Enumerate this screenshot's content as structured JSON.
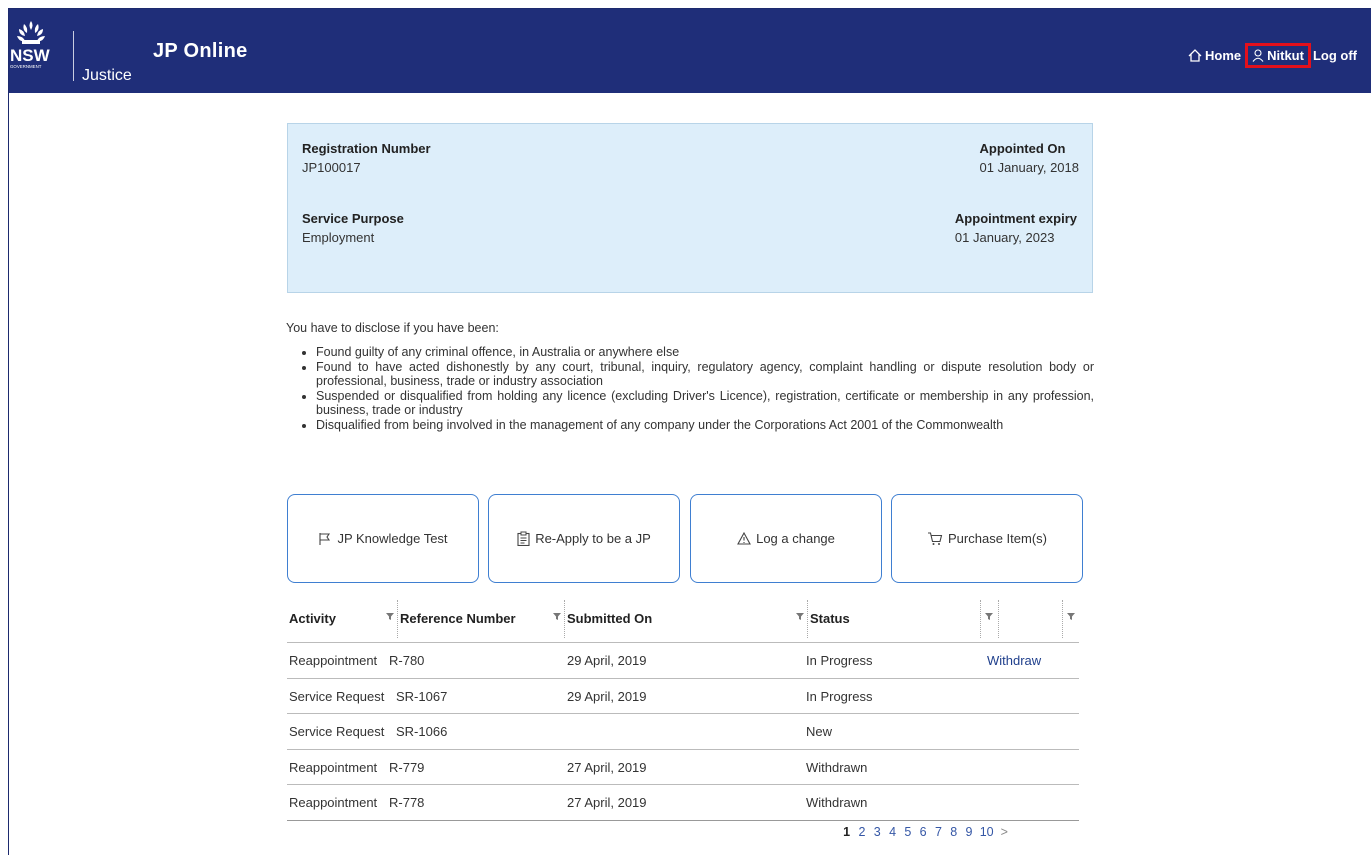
{
  "header": {
    "logo_text": "NSW",
    "logo_subtext": "GOVERNMENT",
    "dept": "Justice",
    "app_title": "JP Online",
    "nav": {
      "home": "Home",
      "user": "Nitkut",
      "logoff": "Log off"
    },
    "highlight_color": "#e3101c",
    "brand_color": "#1f2e79"
  },
  "info": {
    "registration_label": "Registration Number",
    "registration_value": "JP100017",
    "appointed_label": "Appointed On",
    "appointed_value": "01 January, 2018",
    "purpose_label": "Service Purpose",
    "purpose_value": "Employment",
    "expiry_label": "Appointment expiry",
    "expiry_value": "01 January, 2023"
  },
  "disclosure": {
    "intro": "You have to disclose if you have been:",
    "items": [
      "Found guilty of any criminal offence, in Australia or anywhere else",
      "Found to have acted dishonestly by any court, tribunal, inquiry, regulatory agency, complaint handling or dispute resolution body or professional, business, trade or industry association",
      "Suspended or disqualified from holding any licence (excluding Driver's Licence), registration, certificate or membership in any profession, business, trade or industry",
      "Disqualified from being involved in the management of any company under the Corporations Act 2001 of the Commonwealth"
    ]
  },
  "actions": {
    "knowledge_test": "JP Knowledge Test",
    "reapply": "Re-Apply to be a JP",
    "log_change": "Log a change",
    "purchase": "Purchase Item(s)"
  },
  "table": {
    "columns": [
      "Activity",
      "Reference Number",
      "Submitted On",
      "Status",
      ""
    ],
    "rows": [
      {
        "activity": "Reappointment",
        "reference": "R-780",
        "submitted": "29 April, 2019",
        "status": "In Progress",
        "action": "Withdraw"
      },
      {
        "activity": "Service Request",
        "reference": "SR-1067",
        "submitted": "29 April, 2019",
        "status": "In Progress",
        "action": ""
      },
      {
        "activity": "Service Request",
        "reference": "SR-1066",
        "submitted": "",
        "status": "New",
        "action": ""
      },
      {
        "activity": "Reappointment",
        "reference": "R-779",
        "submitted": "27 April, 2019",
        "status": "Withdrawn",
        "action": ""
      },
      {
        "activity": "Reappointment",
        "reference": "R-778",
        "submitted": "27 April, 2019",
        "status": "Withdrawn",
        "action": ""
      }
    ]
  },
  "pager": {
    "pages": [
      "1",
      "2",
      "3",
      "4",
      "5",
      "6",
      "7",
      "8",
      "9",
      "10"
    ],
    "current": "1",
    "next": ">"
  }
}
